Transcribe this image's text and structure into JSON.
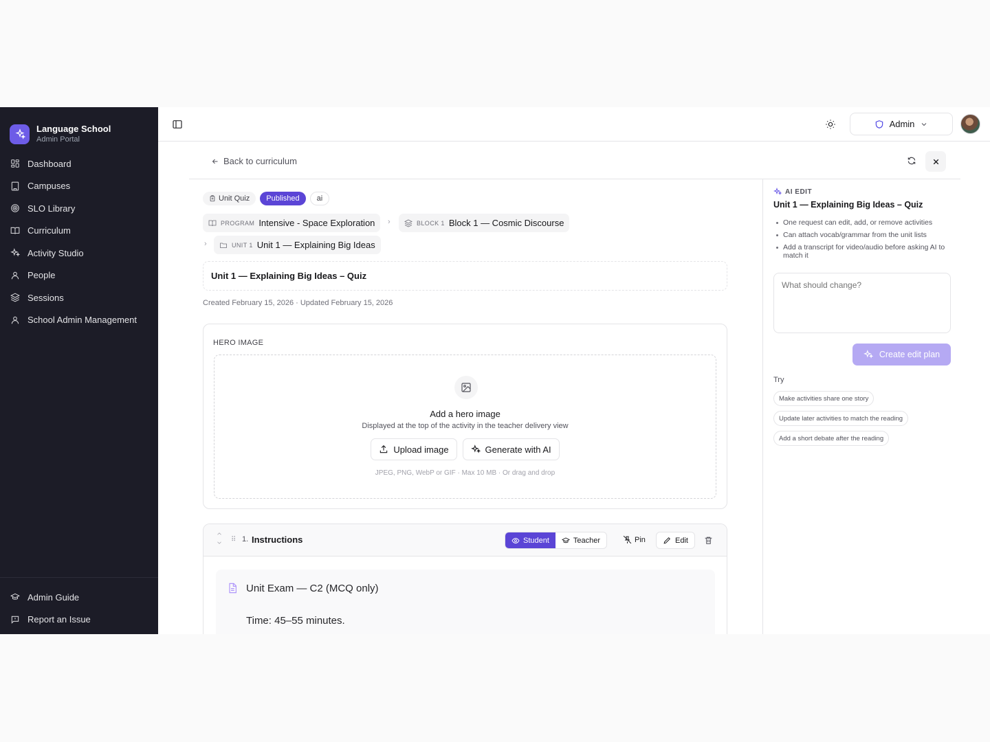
{
  "brand": {
    "title": "Language School",
    "subtitle": "Admin Portal"
  },
  "nav": {
    "items": [
      {
        "label": "Dashboard",
        "icon": "grid-icon"
      },
      {
        "label": "Campuses",
        "icon": "building-icon"
      },
      {
        "label": "SLO Library",
        "icon": "target-icon"
      },
      {
        "label": "Curriculum",
        "icon": "book-open-icon"
      },
      {
        "label": "Activity Studio",
        "icon": "sparkles-icon"
      },
      {
        "label": "People",
        "icon": "user-icon"
      },
      {
        "label": "Sessions",
        "icon": "layers-icon"
      },
      {
        "label": "School Admin Management",
        "icon": "user-icon"
      }
    ],
    "bottom": [
      {
        "label": "Admin Guide",
        "icon": "graduation-cap-icon"
      },
      {
        "label": "Report an Issue",
        "icon": "message-alert-icon"
      }
    ]
  },
  "topbar": {
    "role": "Admin"
  },
  "page": {
    "back_label": "Back to curriculum",
    "chips": {
      "type": "Unit Quiz",
      "status": "Published",
      "source": "ai"
    },
    "breadcrumb": {
      "program_kind": "PROGRAM",
      "program": "Intensive - Space Exploration",
      "block_kind": "BLOCK 1",
      "block": "Block 1 — Cosmic Discourse",
      "unit_kind": "UNIT 1",
      "unit": "Unit 1 — Explaining Big Ideas"
    },
    "title": "Unit 1 — Explaining Big Ideas – Quiz",
    "meta": "Created February 15, 2026 · Updated February 15, 2026"
  },
  "hero": {
    "label": "HERO IMAGE",
    "title": "Add a hero image",
    "subtitle": "Displayed at the top of the activity in the teacher delivery view",
    "upload_label": "Upload image",
    "generate_label": "Generate with AI",
    "hint": "JPEG, PNG, WebP or GIF · Max 10 MB · Or drag and drop"
  },
  "activity": {
    "number": "1.",
    "title": "Instructions",
    "student_label": "Student",
    "teacher_label": "Teacher",
    "pin_label": "Pin",
    "edit_label": "Edit",
    "body_line1": "Unit Exam — C2 (MCQ only)",
    "body_line2": "Time: 45–55 minutes."
  },
  "ai_panel": {
    "kicker": "AI EDIT",
    "title": "Unit 1 — Explaining Big Ideas – Quiz",
    "tips": [
      "One request can edit, add, or remove activities",
      "Can attach vocab/grammar from the unit lists",
      "Add a transcript for video/audio before asking AI to match it"
    ],
    "placeholder": "What should change?",
    "create_label": "Create edit plan",
    "try_label": "Try",
    "suggestions": [
      "Make activities share one story",
      "Update later activities to match the reading",
      "Add a short debate after the reading"
    ]
  },
  "colors": {
    "sidebar": "#1c1c27",
    "accent": "#5b45d6",
    "accent_light": "#b5a9f3"
  }
}
